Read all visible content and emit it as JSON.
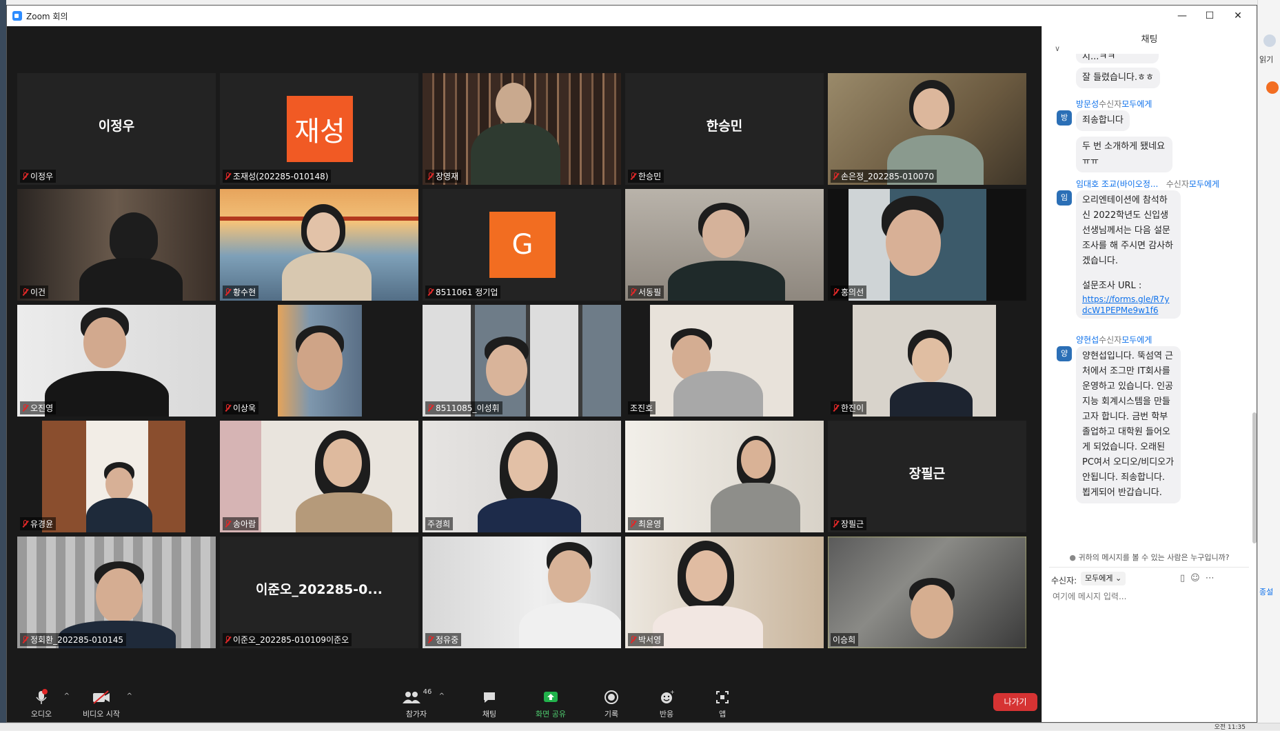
{
  "window": {
    "title": "Zoom 회의"
  },
  "tiles": [
    {
      "name": "이정우",
      "label": "이정우",
      "type": "name"
    },
    {
      "name": "재성",
      "label": "조재성(202285-010148)",
      "type": "avatar",
      "color": "#f15a24"
    },
    {
      "name": "",
      "label": "장영재",
      "type": "video"
    },
    {
      "name": "한승민",
      "label": "한승민",
      "type": "name"
    },
    {
      "name": "",
      "label": "손은정_202285-010070",
      "type": "video"
    },
    {
      "name": "",
      "label": "이건",
      "type": "video"
    },
    {
      "name": "",
      "label": "황수현",
      "type": "video"
    },
    {
      "name": "G",
      "label": "8511061 정기업",
      "type": "avatar",
      "color": "#f26d21"
    },
    {
      "name": "",
      "label": "서동필",
      "type": "video"
    },
    {
      "name": "",
      "label": "홍의선",
      "type": "video"
    },
    {
      "name": "",
      "label": "오진영",
      "type": "video"
    },
    {
      "name": "",
      "label": "이상욱",
      "type": "video"
    },
    {
      "name": "",
      "label": "8511085_이성휘",
      "type": "video"
    },
    {
      "name": "",
      "label": "조진호",
      "type": "video"
    },
    {
      "name": "",
      "label": "한진이",
      "type": "video"
    },
    {
      "name": "",
      "label": "유경윤",
      "type": "video"
    },
    {
      "name": "",
      "label": "송아람",
      "type": "video"
    },
    {
      "name": "",
      "label": "주경희",
      "type": "video"
    },
    {
      "name": "",
      "label": "최윤영",
      "type": "video"
    },
    {
      "name": "장필근",
      "label": "장필근",
      "type": "name"
    },
    {
      "name": "",
      "label": "정회환_202285-010145",
      "type": "video"
    },
    {
      "name": "이준오_202285-0...",
      "label": "이준오_202285-010109이준오",
      "type": "name"
    },
    {
      "name": "",
      "label": "정유중",
      "type": "video"
    },
    {
      "name": "",
      "label": "박서영",
      "type": "video"
    },
    {
      "name": "",
      "label": "이승희",
      "type": "video",
      "active": true
    }
  ],
  "toolbar": {
    "audio": "오디오",
    "video": "비디오 시작",
    "participants": "참가자",
    "participants_count": "46",
    "chat": "채팅",
    "share": "화면 공유",
    "record": "기록",
    "reactions": "반응",
    "apps": "앱",
    "leave": "나가기"
  },
  "chat": {
    "title": "채팅",
    "truncated_top": "시...ㅋㅋ",
    "msg1": "잘 들렸습니다.ㅎㅎ",
    "sender2": "방문성",
    "sender2_to": "수신자",
    "sender2_target": "모두에게",
    "sender2_avatar": "방",
    "msg2a": "죄송합니다",
    "msg2b": "두 번 소개하게 됐네요 ㅠㅠ",
    "sender3": "임대호 조교(바이오정...",
    "sender3_to": "수신자",
    "sender3_target": "모두에게",
    "sender3_avatar": "임",
    "msg3": "오리엔테이션에 참석하신 2022학년도 신입생 선생님께서는 다음 설문조사를 해 주시면 감사하겠습니다.",
    "msg3_url_label": "설문조사 URL :",
    "msg3_url": "https://forms.gle/R7ydcW1PEPMe9w1f6",
    "sender4": "양현섭",
    "sender4_to": "수신자",
    "sender4_target": "모두에게",
    "sender4_avatar": "양",
    "msg4": "양현섭입니다. 뚝섬역 근처에서 조그만 IT회사를 운영하고 있습니다. 인공지능 회계시스템을 만들고자 합니다. 금번 학부 졸업하고 대학원 들어오게 되었습니다. 오래된 PC여서 오디오/비디오가 안됩니다. 죄송합니다. 뵙게되어 반갑습니다.",
    "who_sees": "귀하의 메시지를 볼 수 있는 사람은 누구입니까?",
    "recipient_label": "수신자:",
    "recipient_value": "모두에게",
    "input_placeholder": "여기에 메시지 입력..."
  },
  "desktop": {
    "right_label1": "읽기",
    "right_label2": "종설",
    "clock": "오전 11:35"
  }
}
